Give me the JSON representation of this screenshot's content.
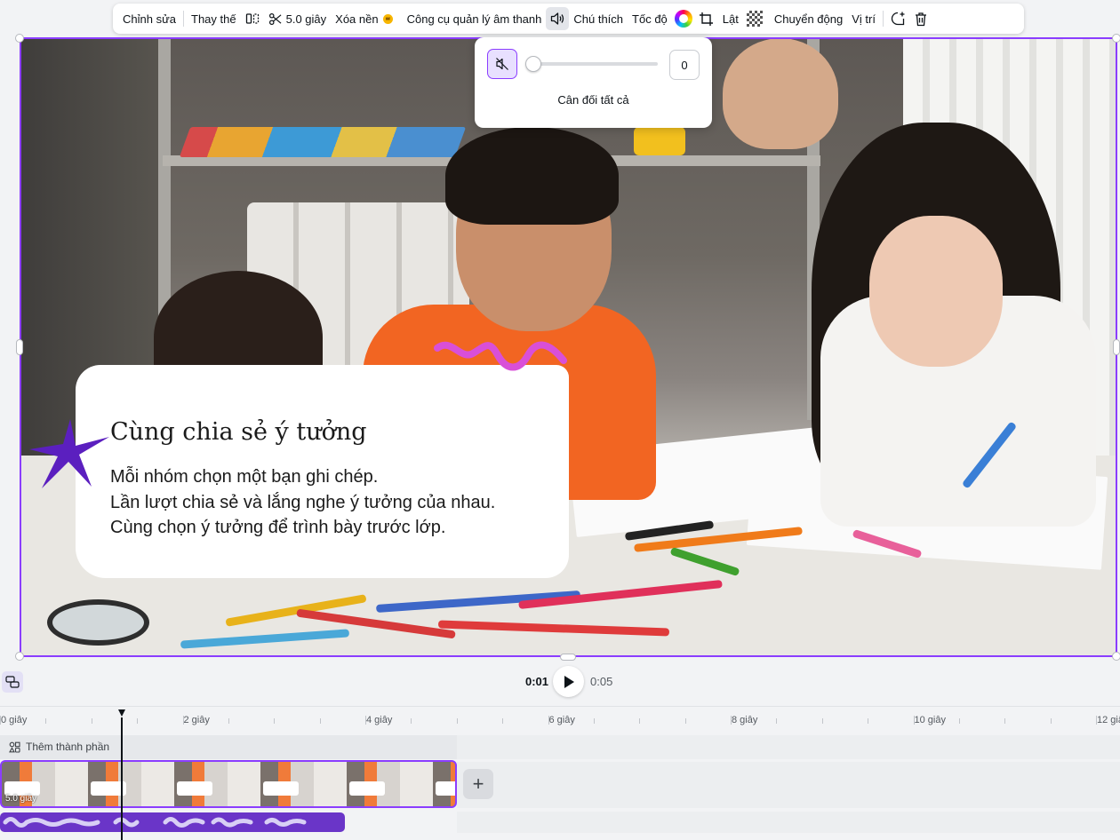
{
  "toolbar": {
    "edit_label": "Chỉnh sửa",
    "replace_label": "Thay thế",
    "split_duration_label": "5.0 giây",
    "bg_remove_label": "Xóa nền",
    "audio_manager_label": "Công cụ quản lý âm thanh",
    "caption_label": "Chú thích",
    "speed_label": "Tốc độ",
    "flip_label": "Lật",
    "motion_label": "Chuyển động",
    "position_label": "Vị trí"
  },
  "volume_popup": {
    "value": "0",
    "level": 0,
    "balance_label": "Cân đối tất cả"
  },
  "card": {
    "title": "Cùng chia sẻ ý tưởng",
    "line1": "Mỗi nhóm chọn một bạn ghi chép.",
    "line2": "Lần lượt chia sẻ và lắng nghe ý tưởng của nhau.",
    "line3": "Cùng chọn ý tưởng để trình bày trước lớp."
  },
  "playback": {
    "current_time": "0:01",
    "total_time": "0:05"
  },
  "timeline": {
    "ruler_labels": [
      "0 giây",
      "2 giây",
      "4 giây",
      "6 giây",
      "8 giây",
      "10 giây",
      "12 giây"
    ],
    "add_elements_label": "Thêm thành phần",
    "clip_duration": "5.0 giây"
  },
  "colors": {
    "accent": "#8b3dff",
    "audio_track": "#6a35c8",
    "star": "#5b1fbf",
    "squiggle": "#d94fd8"
  }
}
